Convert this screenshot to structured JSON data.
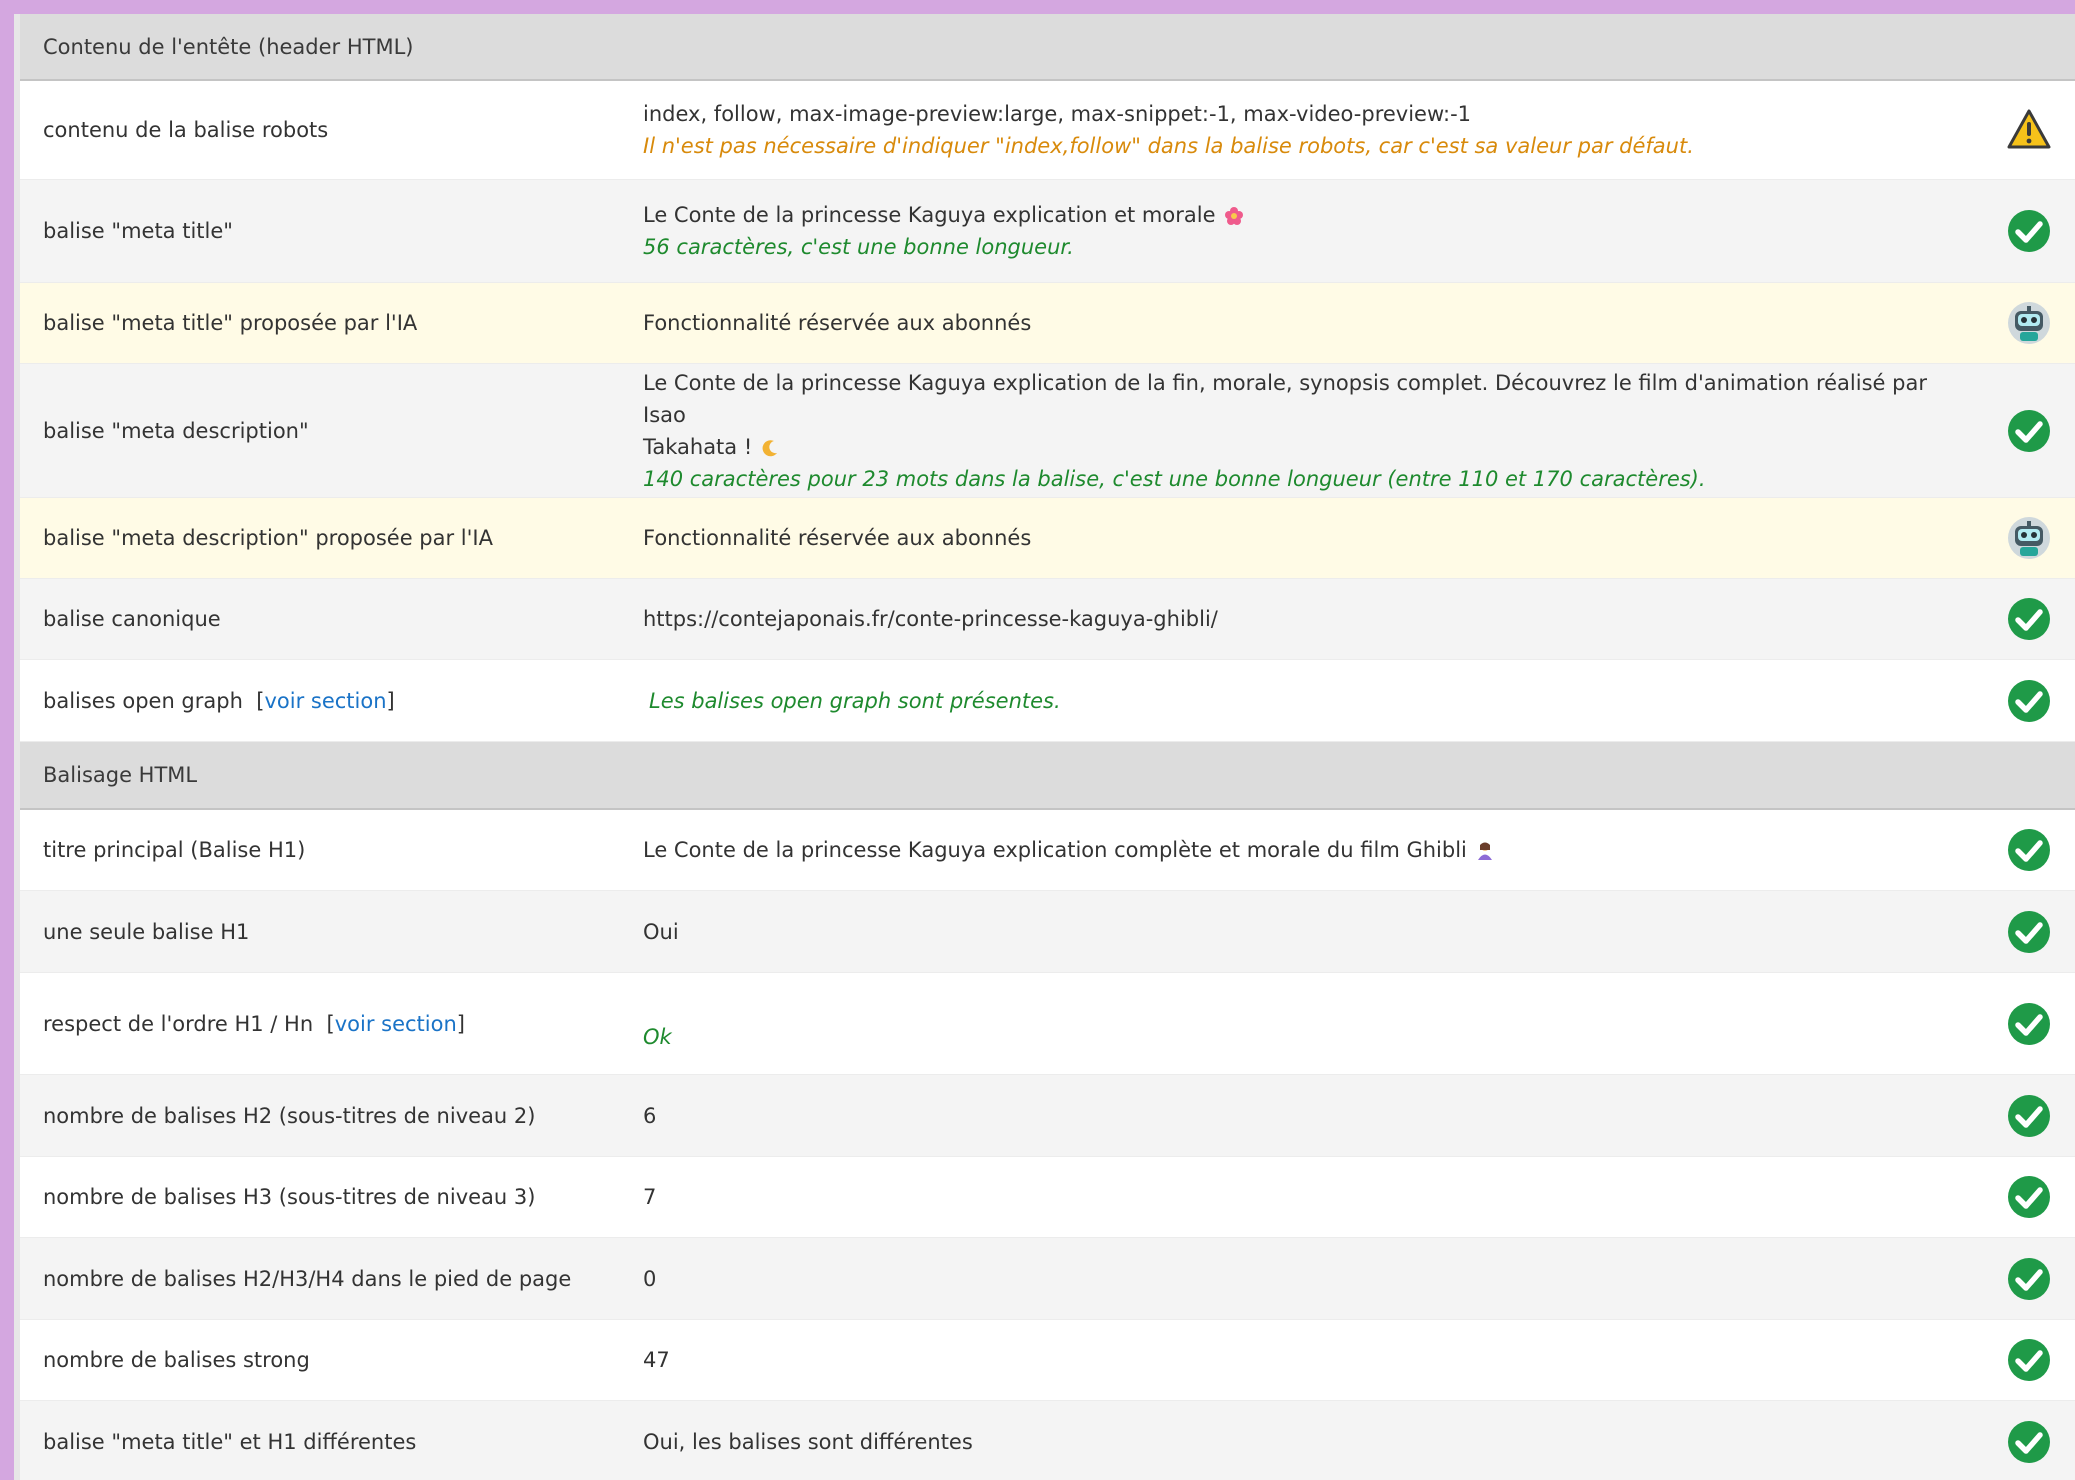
{
  "section_header": {
    "title": "Contenu de l'entête (header HTML)"
  },
  "section_html": {
    "title": "Balisage HTML"
  },
  "rows": {
    "robots": {
      "label": "contenu de la balise robots",
      "value": "index, follow, max-image-preview:large, max-snippet:-1, max-video-preview:-1",
      "note": "Il n'est pas nécessaire d'indiquer \"index,follow\" dans la balise robots, car c'est sa valeur par défaut.",
      "status_icon": "warning-icon"
    },
    "meta_title": {
      "label": "balise \"meta title\"",
      "value": "Le Conte de la princesse Kaguya explication et morale",
      "note": "56 caractères, c'est une bonne longueur.",
      "status_icon": "check-circle-icon"
    },
    "meta_title_ai": {
      "label": "balise \"meta title\" proposée par l'IA",
      "value": "Fonctionnalité réservée aux abonnés",
      "status_icon": "robot-icon"
    },
    "meta_desc": {
      "label": "balise \"meta description\"",
      "value_line1": "Le Conte de la princesse Kaguya explication de la fin, morale, synopsis complet. Découvrez le film d'animation réalisé par Isao",
      "value_line2": "Takahata !",
      "note": "140 caractères pour 23 mots dans la balise, c'est une bonne longueur (entre 110 et 170 caractères).",
      "status_icon": "check-circle-icon"
    },
    "meta_desc_ai": {
      "label": "balise \"meta description\" proposée par l'IA",
      "value": "Fonctionnalité réservée aux abonnés",
      "status_icon": "robot-icon"
    },
    "canonical": {
      "label": "balise canonique",
      "value": "https://contejaponais.fr/conte-princesse-kaguya-ghibli/",
      "status_icon": "check-circle-icon"
    },
    "open_graph": {
      "label": "balises open graph",
      "link": "voir section",
      "note": "Les balises open graph sont présentes.",
      "status_icon": "check-circle-icon"
    },
    "h1": {
      "label": "titre principal (Balise H1)",
      "value": "Le Conte de la princesse Kaguya explication complète et morale du film Ghibli",
      "status_icon": "check-circle-icon"
    },
    "single_h1": {
      "label": "une seule balise H1",
      "value": "Oui",
      "status_icon": "check-circle-icon"
    },
    "order": {
      "label": "respect de l'ordre H1 / Hn",
      "link": "voir section",
      "value": "Ok",
      "status_icon": "check-circle-icon"
    },
    "h2": {
      "label": "nombre de balises H2 (sous-titres de niveau 2)",
      "value": "6",
      "status_icon": "check-circle-icon"
    },
    "h3": {
      "label": "nombre de balises H3 (sous-titres de niveau 3)",
      "value": "7",
      "status_icon": "check-circle-icon"
    },
    "footer_h": {
      "label": "nombre de balises H2/H3/H4 dans le pied de page",
      "value": "0",
      "status_icon": "check-circle-icon"
    },
    "strong": {
      "label": "nombre de balises strong",
      "value": "47",
      "status_icon": "check-circle-icon"
    },
    "title_vs_h1": {
      "label": "balise \"meta title\" et H1 différentes",
      "value": "Oui, les balises sont différentes",
      "status_icon": "check-circle-icon"
    }
  },
  "colors": {
    "ok": "#1e8a2e",
    "warn": "#d88a0b",
    "link": "#1a73c7",
    "ai_row": "#fffbe6"
  }
}
